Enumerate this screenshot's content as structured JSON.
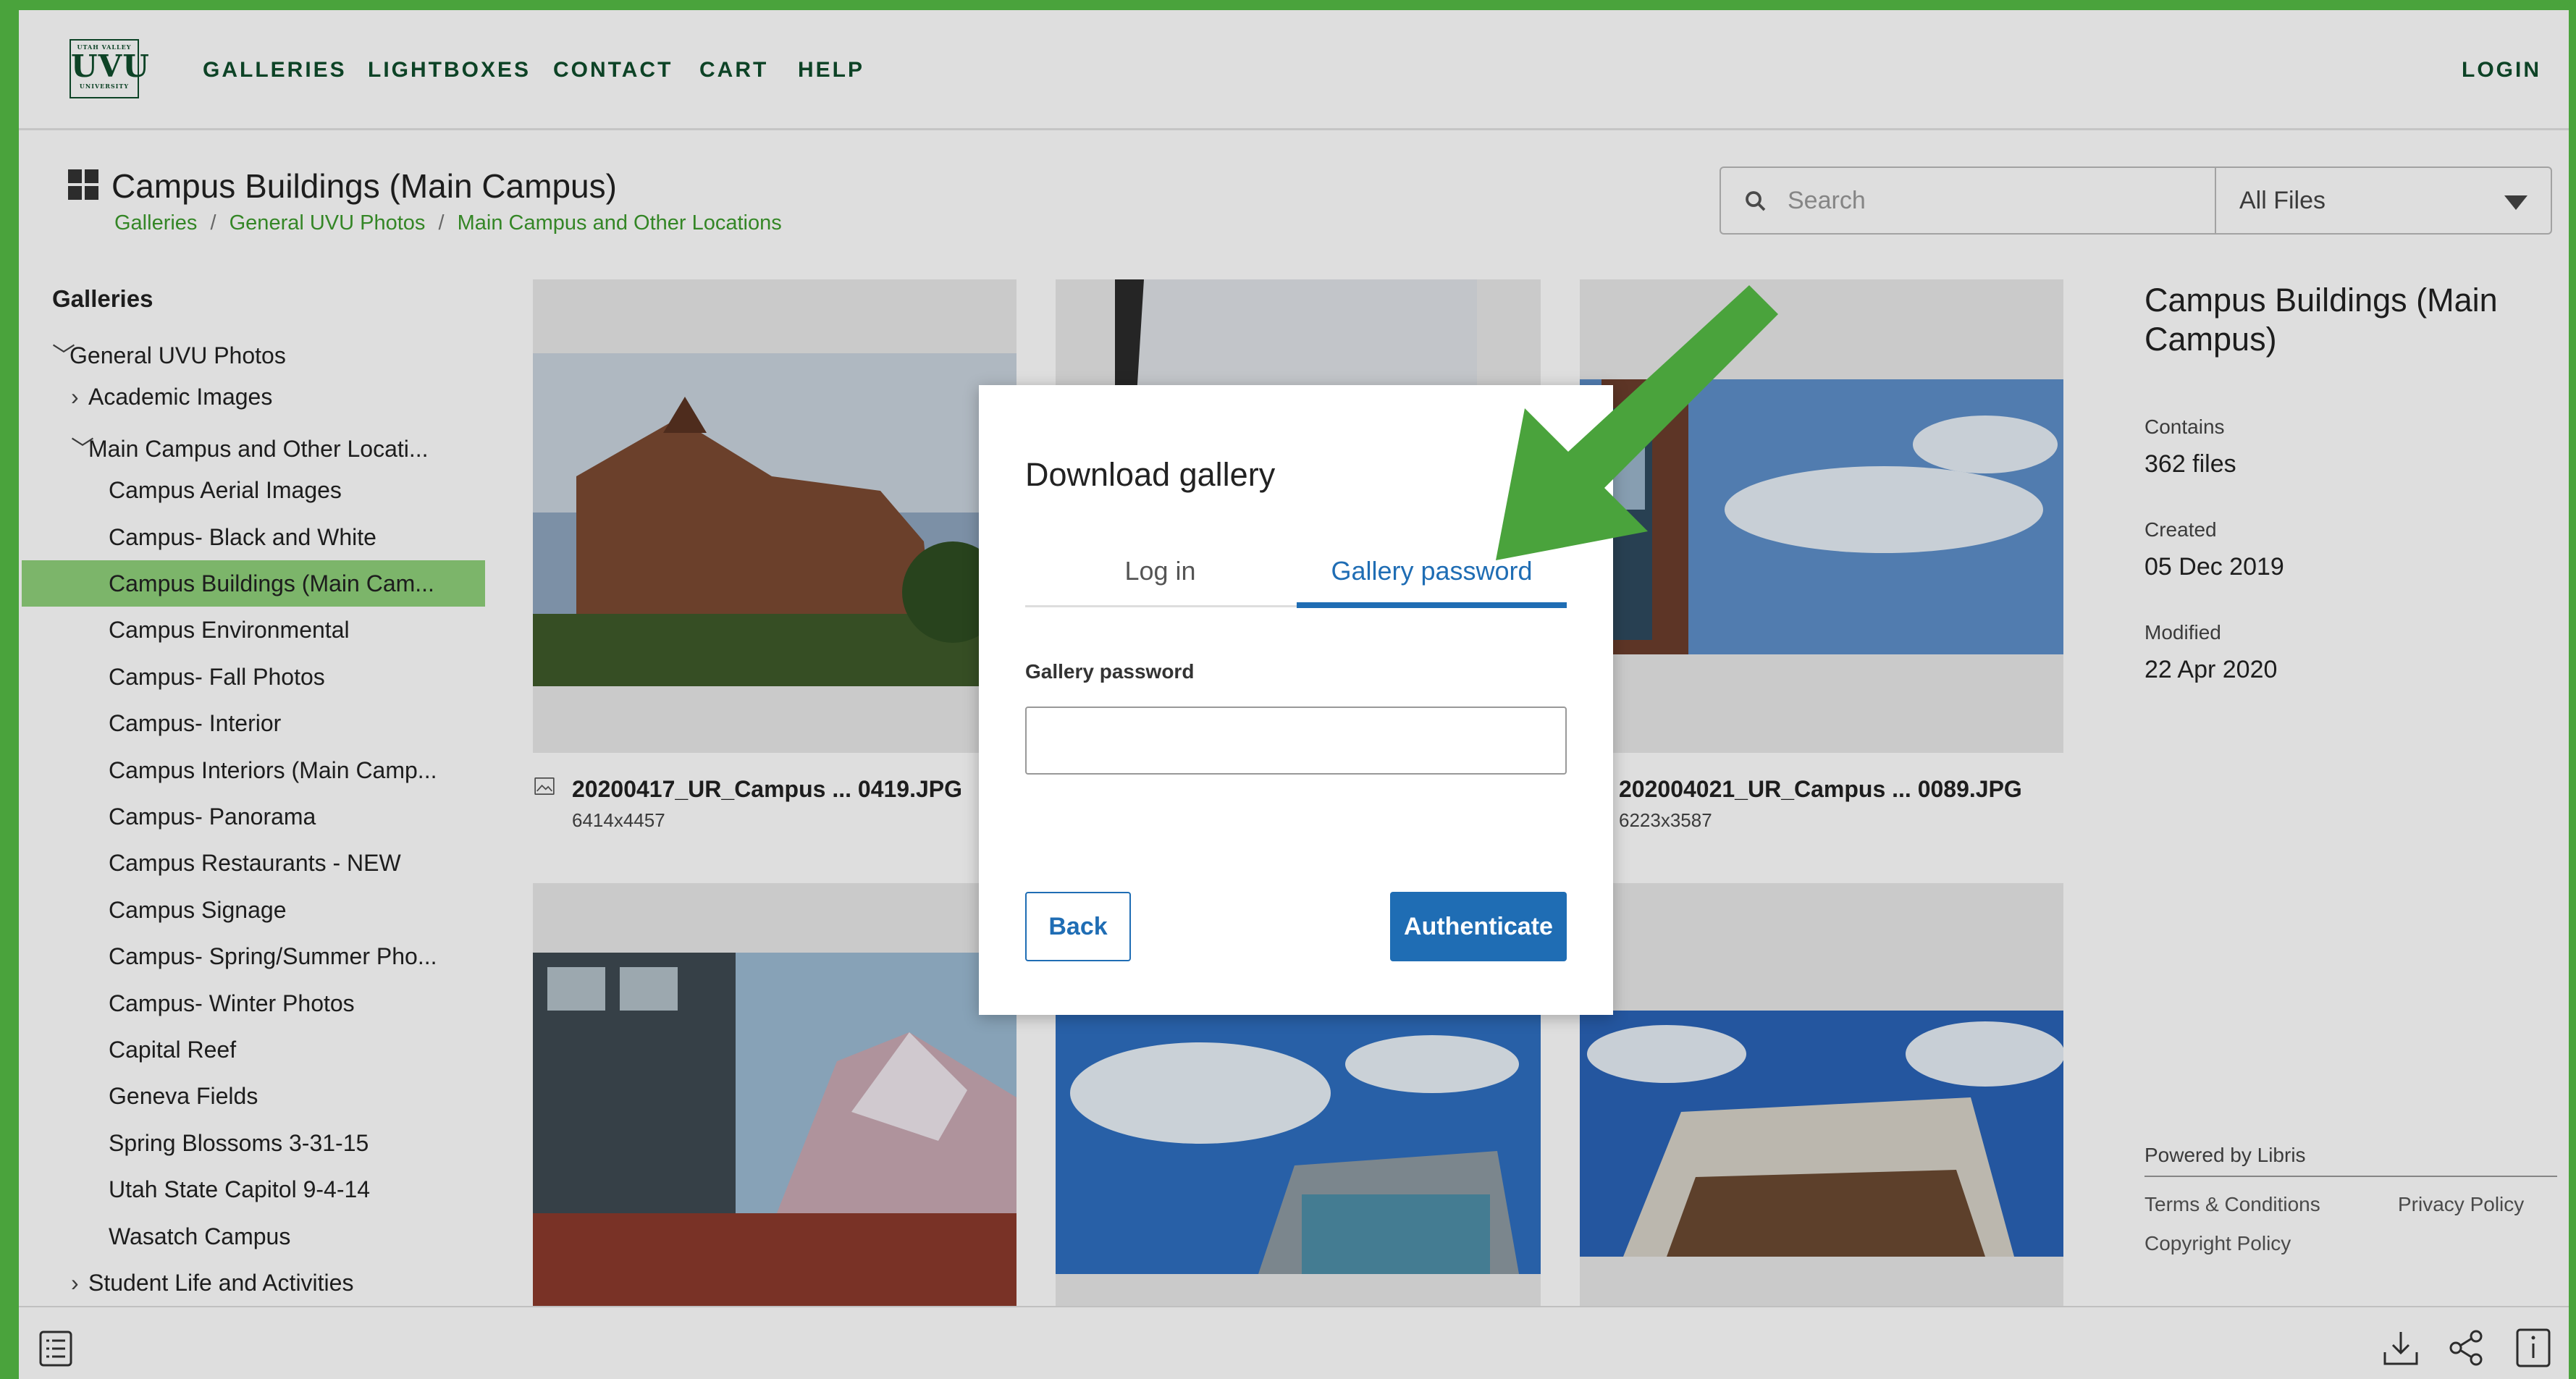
{
  "logo": {
    "top_text": "UTAH VALLEY",
    "main_text": "UVU",
    "bottom_text": "UNIVERSITY"
  },
  "nav": {
    "items": [
      "GALLERIES",
      "LIGHTBOXES",
      "CONTACT",
      "CART",
      "HELP"
    ],
    "login": "LOGIN"
  },
  "header": {
    "title": "Campus Buildings (Main Campus)",
    "breadcrumbs": [
      "Galleries",
      "General UVU Photos",
      "Main Campus and Other Locations"
    ],
    "breadcrumb_sep": "/"
  },
  "search": {
    "placeholder": "Search",
    "filter": "All Files"
  },
  "sidebar": {
    "heading": "Galleries",
    "items": [
      {
        "label": "General UVU Photos",
        "chevron": "﹀"
      },
      {
        "label": "Academic Images",
        "chevron": "›"
      },
      {
        "label": "Main Campus and Other Locati...",
        "chevron": "﹀"
      },
      {
        "label": "Campus Aerial Images"
      },
      {
        "label": "Campus- Black and White"
      },
      {
        "label": "Campus Buildings (Main Cam..."
      },
      {
        "label": "Campus Environmental"
      },
      {
        "label": "Campus- Fall Photos"
      },
      {
        "label": "Campus- Interior"
      },
      {
        "label": "Campus Interiors (Main Camp..."
      },
      {
        "label": "Campus- Panorama"
      },
      {
        "label": "Campus Restaurants - NEW"
      },
      {
        "label": "Campus Signage"
      },
      {
        "label": "Campus- Spring/Summer Pho..."
      },
      {
        "label": "Campus- Winter Photos"
      },
      {
        "label": "Capital Reef"
      },
      {
        "label": "Geneva Fields"
      },
      {
        "label": "Spring Blossoms 3-31-15"
      },
      {
        "label": "Utah State Capitol 9-4-14"
      },
      {
        "label": "Wasatch Campus"
      },
      {
        "label": "Student Life and Activities",
        "chevron": "›"
      }
    ]
  },
  "files": [
    {
      "name": "20200417_UR_Campus ... 0419.JPG",
      "dims": "6414x4457"
    },
    {
      "name": "202004021_UR_Campus ... 0089.JPG",
      "dims": "6223x3587"
    }
  ],
  "right_panel": {
    "title": "Campus Buildings (Main Campus)",
    "contains_label": "Contains",
    "contains_value": "362 files",
    "created_label": "Created",
    "created_value": "05 Dec 2019",
    "modified_label": "Modified",
    "modified_value": "22 Apr 2020",
    "powered": "Powered by Libris",
    "terms": "Terms & Conditions",
    "privacy": "Privacy Policy",
    "copyright": "Copyright Policy"
  },
  "modal": {
    "title": "Download gallery",
    "tab_login": "Log in",
    "tab_password": "Gallery password",
    "field_label": "Gallery password",
    "back": "Back",
    "authenticate": "Authenticate"
  },
  "colors": {
    "frame": "#4aa33c",
    "brand": "#0f4d2c",
    "link": "#3c9a2c",
    "accent": "#1f6db4",
    "active_row": "#8fd07a"
  }
}
